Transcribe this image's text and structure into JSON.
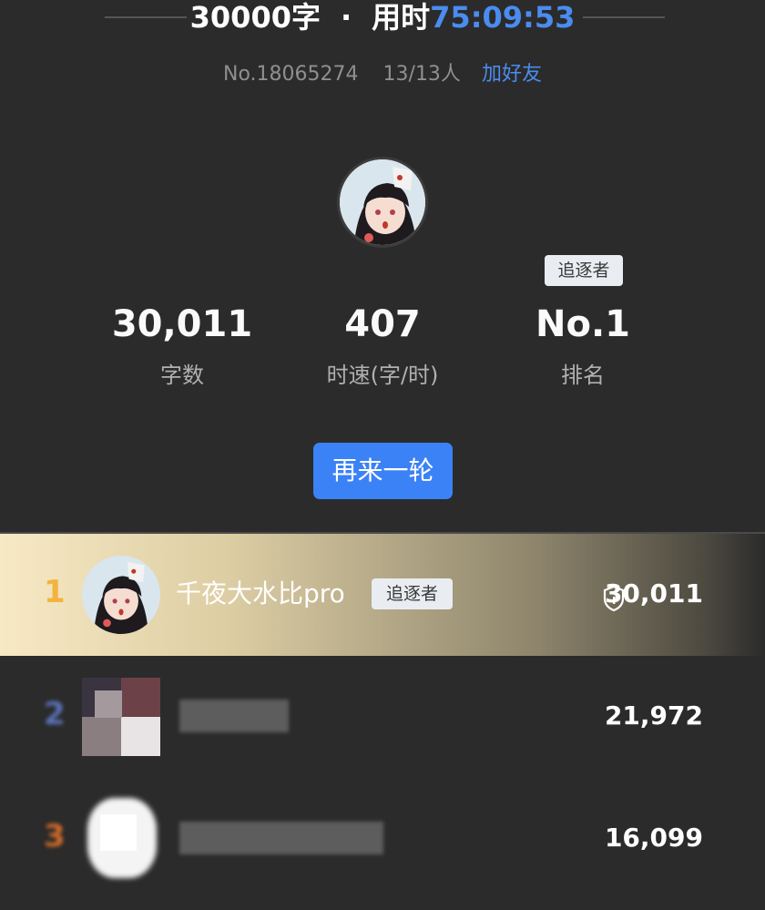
{
  "header": {
    "word_count": "30000字",
    "separator": "·",
    "time_label": "用时",
    "time_value": "75:09:53"
  },
  "subinfo": {
    "room_no": "No.18065274",
    "players": "13/13人",
    "add_friend": "加好友"
  },
  "badge": "追逐者",
  "stats": [
    {
      "value": "30,011",
      "label": "字数"
    },
    {
      "value": "407",
      "label": "时速(字/时)"
    },
    {
      "value": "No.1",
      "label": "排名"
    }
  ],
  "again_button": "再来一轮",
  "ranking": [
    {
      "rank": "1",
      "name": "千夜大水比pro",
      "badge": "追逐者",
      "score": "30,011"
    },
    {
      "rank": "2",
      "name": "",
      "score": "21,972"
    },
    {
      "rank": "3",
      "name": "",
      "score": "16,099"
    }
  ],
  "colors": {
    "accent": "#4a8cf0",
    "button": "#3b82f6",
    "rank1": "#f4b23e",
    "background": "#2b2b2b"
  }
}
